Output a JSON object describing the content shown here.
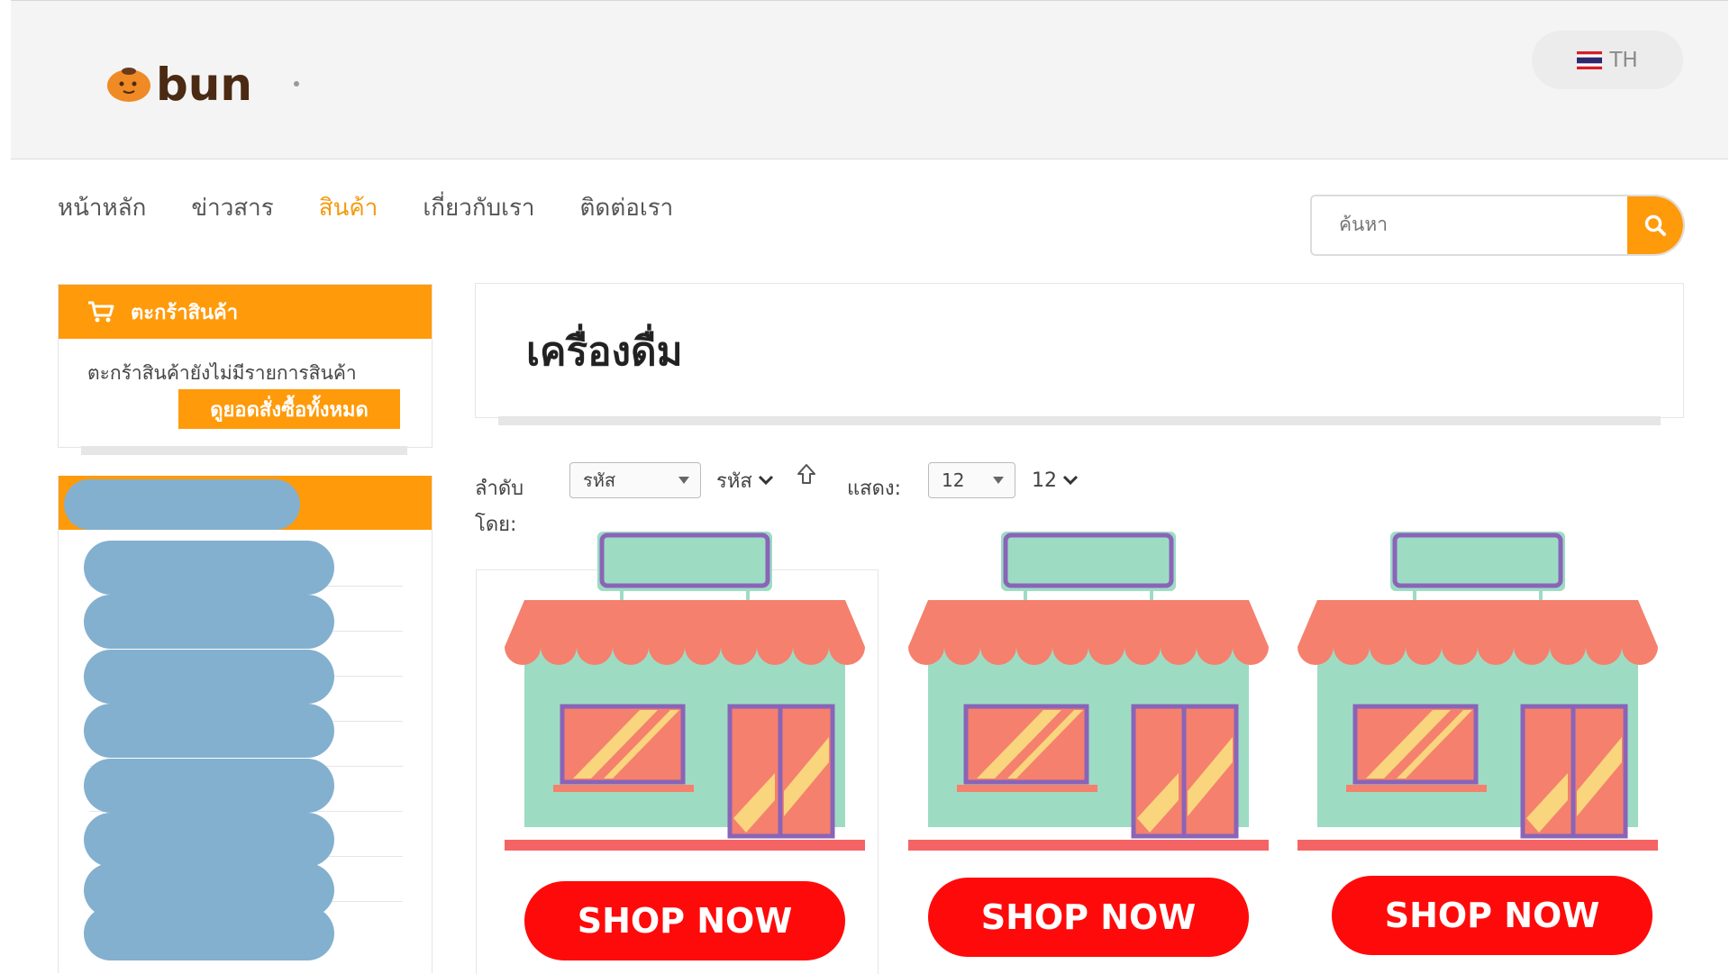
{
  "header": {
    "logo_text": "bun",
    "language": "TH"
  },
  "nav": {
    "items": [
      "หน้าหลัก",
      "ข่าวสาร",
      "สินค้า",
      "เกี่ยวกับเรา",
      "ติดต่อเรา"
    ],
    "active": "สินค้า"
  },
  "search": {
    "placeholder": "ค้นหา"
  },
  "cart": {
    "title": "ตะกร้าสินค้า",
    "empty_message": "ตะกร้าสินค้ายังไม่มีรายการสินค้า",
    "view_orders_label": "ดูยอดสั่งซื้อทั้งหมด"
  },
  "category": {
    "title": "เครื่องดื่ม"
  },
  "sort": {
    "label_line1": "ลำดับ",
    "label_line2": "โดย:",
    "select_value": "รหัส",
    "dropdown_value": "รหัส",
    "show_label": "แสดง:",
    "show_select_value": "12",
    "show_dropdown_value": "12"
  },
  "products": [
    {
      "button_label": "SHOP NOW"
    },
    {
      "button_label": "SHOP NOW"
    },
    {
      "button_label": "SHOP NOW"
    }
  ],
  "colors": {
    "accent": "#ff9a0a",
    "active_nav": "#f39a0e",
    "shop_button": "#ff0a0a",
    "redacted": "#83b0cf",
    "store_wall": "#9ddcc3",
    "store_awning": "#f5806d",
    "store_frame": "#8a64b8",
    "store_glass_stripe": "#f9d57e"
  }
}
